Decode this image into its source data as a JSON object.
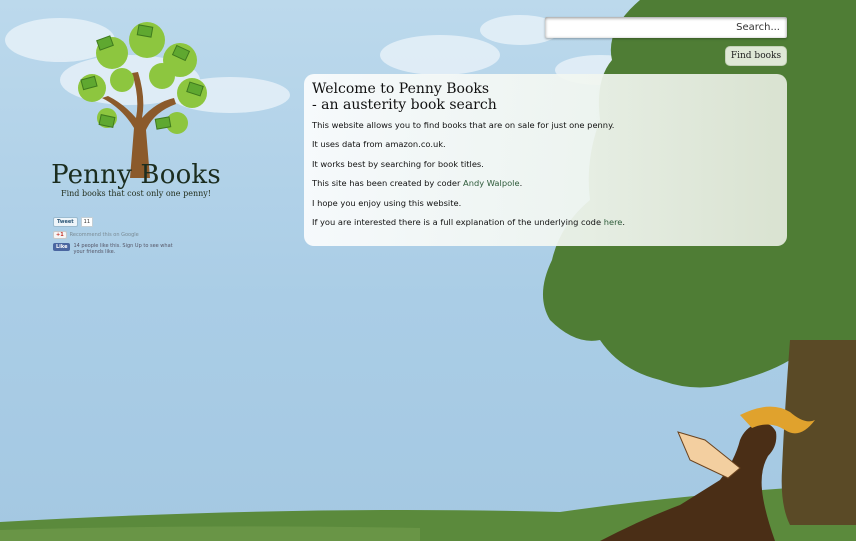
{
  "brand": {
    "name": "Penny Books",
    "tagline": "Find books that cost only one penny!"
  },
  "social": {
    "tweet_label": "Tweet",
    "tweet_count": "11",
    "gplus_label": "+1",
    "gplus_text": "Recommend this on Google",
    "fb_label": "Like",
    "fb_text": "14 people like this. Sign Up to see what your friends like."
  },
  "search": {
    "placeholder": "Search..."
  },
  "find_button": "Find books",
  "panel": {
    "title_line1": "Welcome to Penny Books",
    "title_line2": "- an austerity book search",
    "lines": [
      "This website allows you to find books that are on sale for just one penny.",
      "It uses data from amazon.co.uk.",
      "It works best by searching for book titles."
    ],
    "creator_prefix": "This site has been created by coder ",
    "creator_link": "Andy Walpole",
    "creator_suffix": ".",
    "enjoy": "I hope you enjoy using this website.",
    "explain_prefix": "If you are interested there is a full explanation of the underlying code ",
    "explain_link": "here",
    "explain_suffix": "."
  },
  "colors": {
    "sky": "#aacde6",
    "tree": "#4f7d35",
    "grass": "#5b8a3c",
    "link": "#2e5b3a",
    "button": "#dfe8d6"
  }
}
